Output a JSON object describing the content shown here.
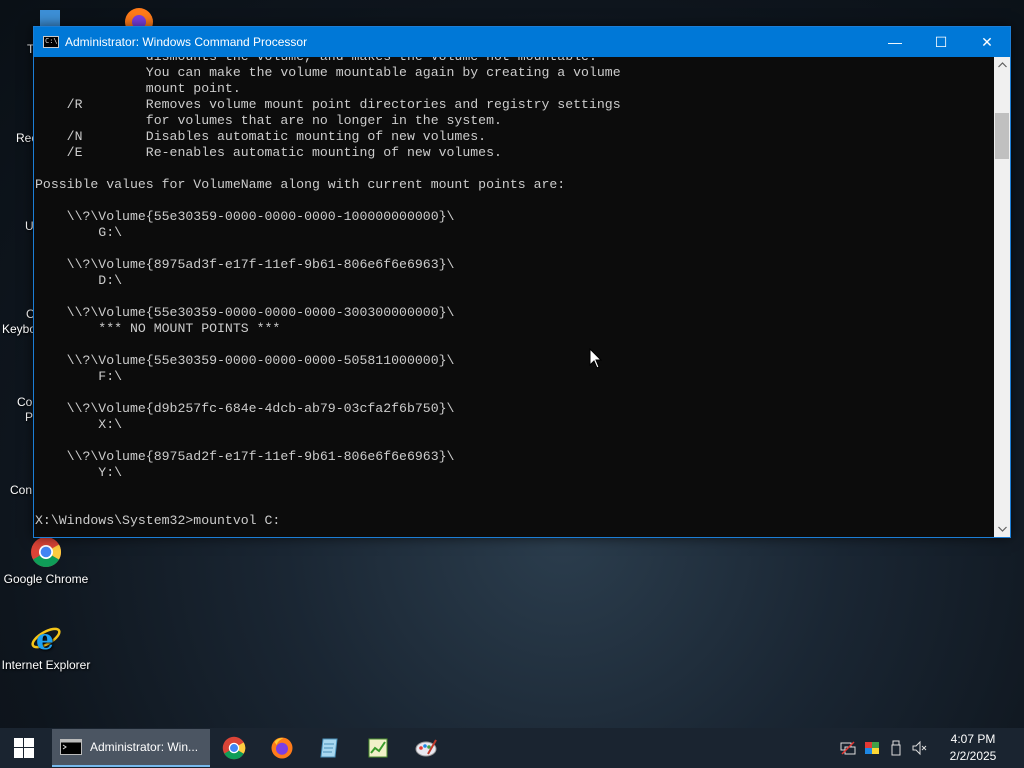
{
  "desktop": {
    "icons": [
      {
        "label": "Google Chrome"
      },
      {
        "label": "Internet Explorer"
      }
    ],
    "partial_labels": [
      "T",
      "Rec",
      "U",
      "C",
      "Keybo",
      "Co",
      "P",
      "Con"
    ]
  },
  "window": {
    "title": "Administrator: Windows Command Processor",
    "icon_text": "C:\\",
    "minimize": "—",
    "maximize": "☐",
    "close": "✕",
    "console_lines": [
      "              dismounts the volume, and makes the volume not mountable.",
      "              You can make the volume mountable again by creating a volume",
      "              mount point.",
      "    /R        Removes volume mount point directories and registry settings",
      "              for volumes that are no longer in the system.",
      "    /N        Disables automatic mounting of new volumes.",
      "    /E        Re-enables automatic mounting of new volumes.",
      "",
      "Possible values for VolumeName along with current mount points are:",
      "",
      "    \\\\?\\Volume{55e30359-0000-0000-0000-100000000000}\\",
      "        G:\\",
      "",
      "    \\\\?\\Volume{8975ad3f-e17f-11ef-9b61-806e6f6e6963}\\",
      "        D:\\",
      "",
      "    \\\\?\\Volume{55e30359-0000-0000-0000-300300000000}\\",
      "        *** NO MOUNT POINTS ***",
      "",
      "    \\\\?\\Volume{55e30359-0000-0000-0000-505811000000}\\",
      "        F:\\",
      "",
      "    \\\\?\\Volume{d9b257fc-684e-4dcb-ab79-03cfa2f6b750}\\",
      "        X:\\",
      "",
      "    \\\\?\\Volume{8975ad2f-e17f-11ef-9b61-806e6f6e6963}\\",
      "        Y:\\",
      "",
      "",
      "X:\\Windows\\System32>mountvol C:"
    ]
  },
  "taskbar": {
    "active_task_label": "Administrator: Win...",
    "pinned": [
      "chrome-icon",
      "firefox-icon",
      "notepad-icon",
      "spreadsheet-icon",
      "paint-icon"
    ],
    "clock": {
      "time": "4:07 PM",
      "date": "2/2/2025"
    }
  },
  "colors": {
    "titlebar": "#0078d7",
    "console_bg": "#0c0c0c",
    "console_text": "#cccccc",
    "taskbar": "#1a2430"
  }
}
